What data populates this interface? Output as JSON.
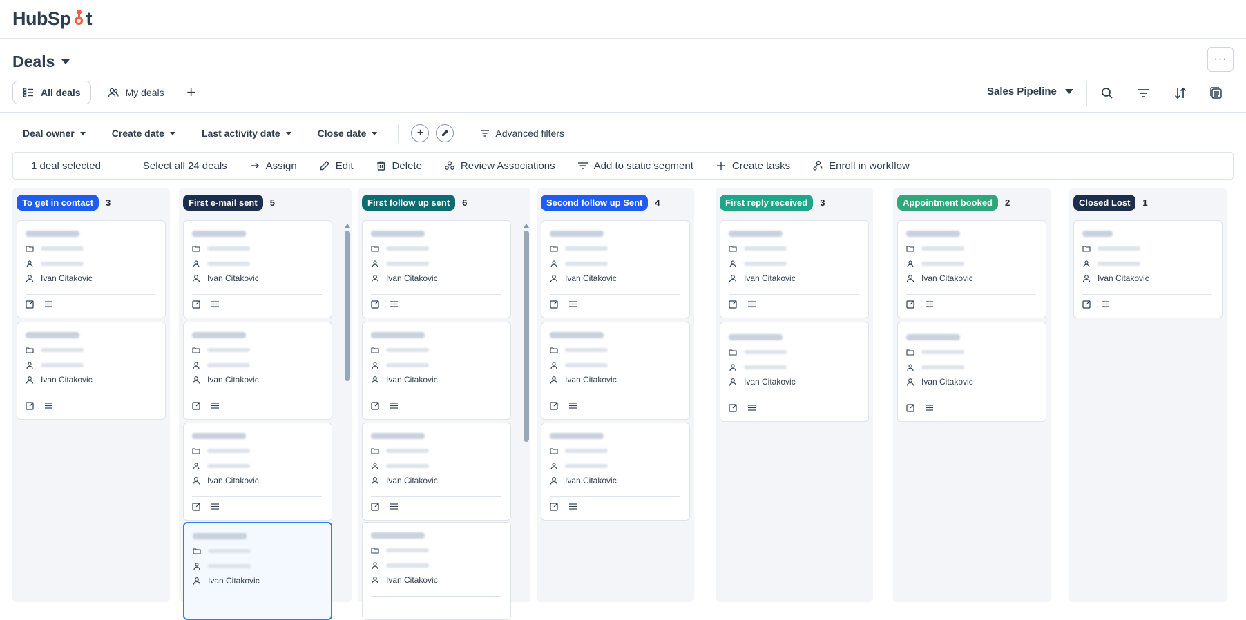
{
  "brand": {
    "logo_text_a": "HubSp",
    "logo_text_b": "t"
  },
  "page": {
    "title": "Deals",
    "more_label": "···"
  },
  "views": {
    "all_deals": "All deals",
    "my_deals": "My deals",
    "add": "+"
  },
  "pipeline": {
    "label": "Sales Pipeline"
  },
  "filters": {
    "deal_owner": "Deal owner",
    "create_date": "Create date",
    "last_activity": "Last activity date",
    "close_date": "Close date",
    "advanced": "Advanced filters"
  },
  "bulk": {
    "selected": "1 deal selected",
    "select_all": "Select all 24 deals",
    "assign": "Assign",
    "edit": "Edit",
    "delete": "Delete",
    "review": "Review Associations",
    "static_segment": "Add to static segment",
    "create_tasks": "Create tasks",
    "enroll": "Enroll in workflow"
  },
  "owner_name": "Ivan Citakovic",
  "colors": {
    "to_get_in_contact": "#1f5cf0",
    "first_email_sent": "#1d2e4d",
    "first_follow_up": "#0e6b72",
    "second_follow_up": "#1f5cf0",
    "first_reply": "#1ea689",
    "appointment": "#2ea87a",
    "closed_lost": "#1d2e4d",
    "selected_border": "#2f7ef0"
  },
  "columns": [
    {
      "label": "To get in contact",
      "count": "3"
    },
    {
      "label": "First e-mail sent",
      "count": "5"
    },
    {
      "label": "First follow up sent",
      "count": "6"
    },
    {
      "label": "Second follow up Sent",
      "count": "4"
    },
    {
      "label": "First reply received",
      "count": "3"
    },
    {
      "label": "Appointment booked",
      "count": "2"
    },
    {
      "label": "Closed Lost",
      "count": "1"
    }
  ]
}
